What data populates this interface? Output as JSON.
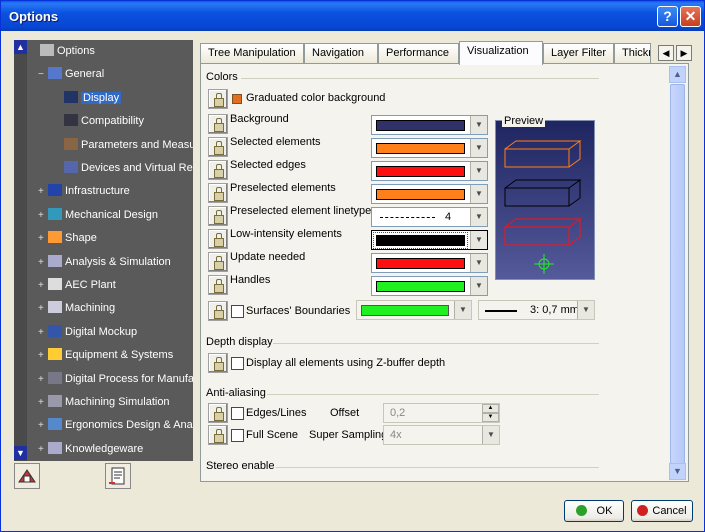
{
  "window": {
    "title": "Options"
  },
  "titlebar": {
    "help_glyph": "?",
    "close_glyph": "✕"
  },
  "tree": {
    "items": [
      {
        "label": "Options",
        "icon": "options-icon",
        "expand": ""
      },
      {
        "label": "General",
        "icon": "general-icon",
        "expand": "−"
      },
      {
        "label": "Display",
        "icon": "display-icon",
        "expand": "",
        "selected": true
      },
      {
        "label": "Compatibility",
        "icon": "compatibility-icon",
        "expand": ""
      },
      {
        "label": "Parameters and Measure",
        "icon": "parameters-icon",
        "expand": ""
      },
      {
        "label": "Devices and Virtual Realit",
        "icon": "devices-icon",
        "expand": ""
      },
      {
        "label": "Infrastructure",
        "icon": "infrastructure-icon",
        "expand": "+"
      },
      {
        "label": "Mechanical Design",
        "icon": "mechanical-design-icon",
        "expand": "+"
      },
      {
        "label": "Shape",
        "icon": "shape-icon",
        "expand": "+"
      },
      {
        "label": "Analysis & Simulation",
        "icon": "analysis-icon",
        "expand": "+"
      },
      {
        "label": "AEC Plant",
        "icon": "aec-plant-icon",
        "expand": "+"
      },
      {
        "label": "Machining",
        "icon": "machining-icon",
        "expand": "+"
      },
      {
        "label": "Digital Mockup",
        "icon": "digital-mockup-icon",
        "expand": "+"
      },
      {
        "label": "Equipment & Systems",
        "icon": "equipment-icon",
        "expand": "+"
      },
      {
        "label": "Digital Process for Manufact",
        "icon": "digital-process-icon",
        "expand": "+"
      },
      {
        "label": "Machining Simulation",
        "icon": "machining-sim-icon",
        "expand": "+"
      },
      {
        "label": "Ergonomics Design & Analys",
        "icon": "ergonomics-icon",
        "expand": "+"
      },
      {
        "label": "Knowledgeware",
        "icon": "knowledgeware-icon",
        "expand": "+"
      }
    ]
  },
  "tabs": [
    {
      "label": "Tree Manipulation"
    },
    {
      "label": "Navigation"
    },
    {
      "label": "Performance"
    },
    {
      "label": "Visualization",
      "active": true
    },
    {
      "label": "Layer Filter"
    },
    {
      "label": "Thickn"
    }
  ],
  "colors_section": {
    "title": "Colors",
    "graduated_label": "Graduated color background",
    "rows": [
      {
        "label": "Background",
        "color": "#30306a"
      },
      {
        "label": "Selected elements",
        "color": "#ff7f1a"
      },
      {
        "label": "Selected edges",
        "color": "#ff1010"
      },
      {
        "label": "Preselected elements",
        "color": "#ff7f1a"
      },
      {
        "label": "Preselected element linetype",
        "linetype": "4"
      },
      {
        "label": "Low-intensity elements",
        "color": "#000000"
      },
      {
        "label": "Update needed",
        "color": "#ff1010"
      },
      {
        "label": "Handles",
        "color": "#20f020"
      }
    ],
    "surfaces_label": "Surfaces' Boundaries",
    "surfaces_color": "#20f020",
    "surfaces_thickness": "3: 0,7 mm",
    "preview_title": "Preview"
  },
  "depth_section": {
    "title": "Depth display",
    "zbuffer_label": "Display all elements using Z-buffer depth"
  },
  "antialias_section": {
    "title": "Anti-aliasing",
    "edges_label": "Edges/Lines",
    "offset_label": "Offset",
    "offset_value": "0,2",
    "fullscene_label": "Full Scene",
    "supersampling_label": "Super Sampling",
    "supersampling_value": "4x"
  },
  "stereo_section": {
    "title": "Stereo enable"
  },
  "buttons": {
    "ok": "OK",
    "cancel": "Cancel"
  },
  "accent": {
    "tree_selection": "#316ac5",
    "titlebar": "#0a52e0"
  }
}
